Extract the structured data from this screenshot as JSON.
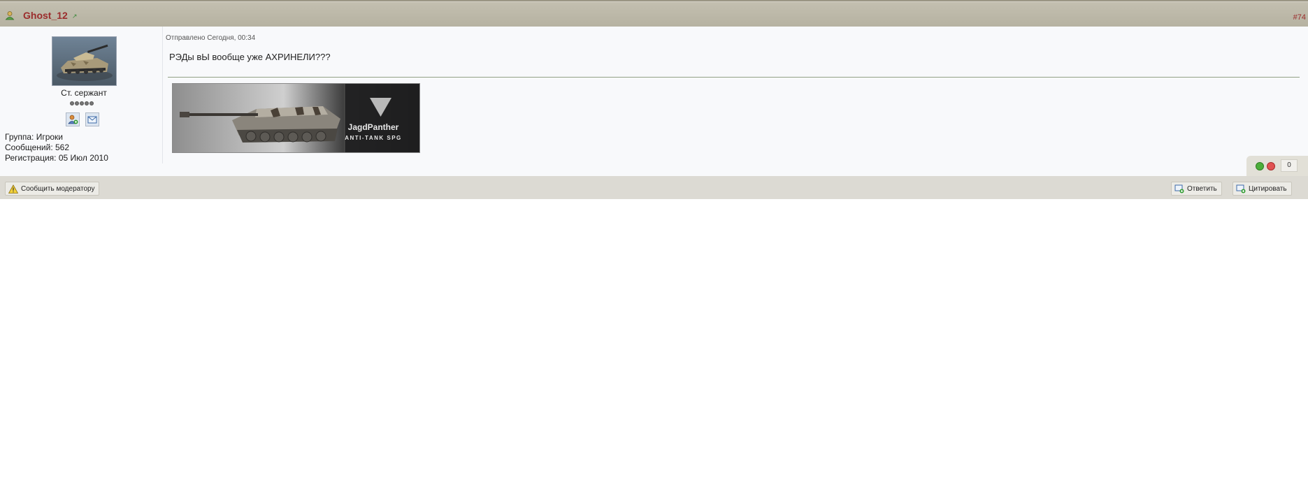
{
  "post": {
    "author": "Ghost_12",
    "number": "#74",
    "meta": "Отправлено Сегодня, 00:34",
    "text": "РЭДы вЫ вообще уже АХРИНЕЛИ???"
  },
  "author_info": {
    "rank": "Ст. сержант",
    "rank_pips": 5,
    "group": "Группа: Игроки",
    "posts": "Сообщений: 562",
    "registered": "Регистрация: 05 Июл 2010"
  },
  "signature": {
    "title": "JagdPanther",
    "subtitle": "ANTI-TANK SPG"
  },
  "reputation": {
    "count": "0"
  },
  "footer": {
    "report_label": "Сообщить модератору",
    "reply_label": "Ответить",
    "quote_label": "Цитировать"
  },
  "colors": {
    "author": "#9b2c2c",
    "header_bg": "#b8b4a3",
    "footer_bg": "#dcdad3"
  }
}
